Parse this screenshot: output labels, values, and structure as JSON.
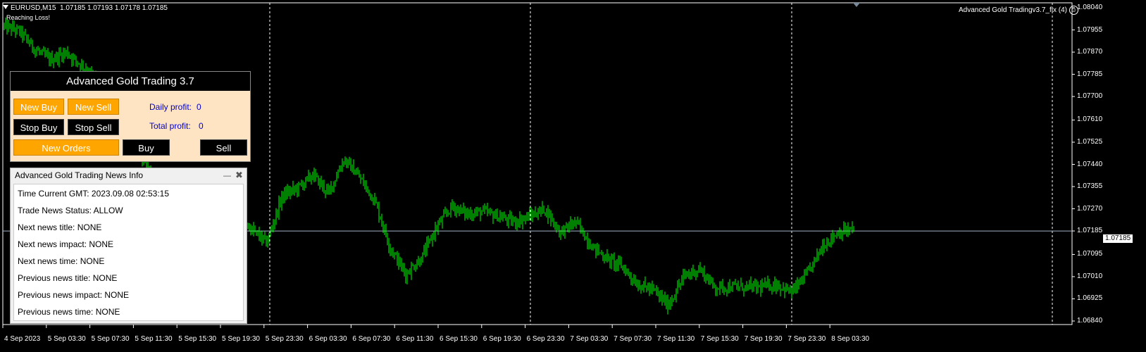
{
  "header": {
    "symbol": "EURUSD,M15",
    "ohlc": "1.07185 1.07193 1.07178 1.07185",
    "status": "Reaching Loss!",
    "ea_name": "Advanced Gold Tradingv3.7_fix (4)"
  },
  "price_axis": {
    "labels": [
      "1.08040",
      "1.07955",
      "1.07870",
      "1.07785",
      "1.07700",
      "1.07610",
      "1.07525",
      "1.07440",
      "1.07355",
      "1.07270",
      "1.07185",
      "1.07095",
      "1.07010",
      "1.06925",
      "1.06840"
    ],
    "current": "1.07185"
  },
  "time_axis": {
    "labels": [
      "4 Sep 2023",
      "5 Sep 03:30",
      "5 Sep 07:30",
      "5 Sep 11:30",
      "5 Sep 15:30",
      "5 Sep 19:30",
      "5 Sep 23:30",
      "6 Sep 03:30",
      "6 Sep 07:30",
      "6 Sep 11:30",
      "6 Sep 15:30",
      "6 Sep 19:30",
      "6 Sep 23:30",
      "7 Sep 03:30",
      "7 Sep 07:30",
      "7 Sep 11:30",
      "7 Sep 15:30",
      "7 Sep 19:30",
      "7 Sep 23:30",
      "8 Sep 03:30"
    ]
  },
  "trade_panel": {
    "title": "Advanced Gold Trading 3.7",
    "new_buy": "New Buy",
    "new_sell": "New Sell",
    "stop_buy": "Stop Buy",
    "stop_sell": "Stop Sell",
    "new_orders": "New Orders",
    "buy": "Buy",
    "sell": "Sell",
    "daily_profit_label": "Daily profit:",
    "daily_profit_value": "0",
    "total_profit_label": "Total profit:",
    "total_profit_value": "0"
  },
  "news_panel": {
    "title": "Advanced Gold Trading News Info",
    "lines": [
      "Time Current GMT: 2023.09.08 02:53:15",
      "Trade News Status: ALLOW",
      "Next news title: NONE",
      "Next news impact: NONE",
      "Next news time: NONE",
      "Previous news title: NONE",
      "Previous news impact: NONE",
      "Previous news time: NONE"
    ]
  },
  "chart_data": {
    "type": "candlestick",
    "symbol": "EURUSD",
    "timeframe": "M15",
    "ylim": [
      1.0684,
      1.0804
    ],
    "current_price": 1.07185,
    "close_path": [
      [
        0,
        1.0797
      ],
      [
        1,
        1.0795
      ],
      [
        2,
        1.0788
      ],
      [
        3,
        1.0784
      ],
      [
        4,
        1.0787
      ],
      [
        5,
        1.0782
      ],
      [
        6,
        1.0777
      ],
      [
        7,
        1.0768
      ],
      [
        8,
        1.0758
      ],
      [
        9,
        1.0745
      ],
      [
        10,
        1.0737
      ],
      [
        11,
        1.073
      ],
      [
        12,
        1.0722
      ],
      [
        13,
        1.0718
      ],
      [
        14,
        1.0722
      ],
      [
        15,
        1.0725
      ],
      [
        16,
        1.0719
      ],
      [
        17,
        1.0714
      ],
      [
        18,
        1.0732
      ],
      [
        19,
        1.0735
      ],
      [
        20,
        1.074
      ],
      [
        21,
        1.0733
      ],
      [
        22,
        1.0746
      ],
      [
        23,
        1.0739
      ],
      [
        24,
        1.073
      ],
      [
        25,
        1.0712
      ],
      [
        26,
        1.0702
      ],
      [
        27,
        1.0708
      ],
      [
        28,
        1.072
      ],
      [
        29,
        1.0728
      ],
      [
        30,
        1.0725
      ],
      [
        31,
        1.0726
      ],
      [
        32,
        1.0724
      ],
      [
        33,
        1.0722
      ],
      [
        34,
        1.0724
      ],
      [
        35,
        1.0727
      ],
      [
        36,
        1.0718
      ],
      [
        37,
        1.0722
      ],
      [
        38,
        1.0713
      ],
      [
        39,
        1.0708
      ],
      [
        40,
        1.0705
      ],
      [
        41,
        1.0698
      ],
      [
        42,
        1.0696
      ],
      [
        43,
        1.069
      ],
      [
        44,
        1.0701
      ],
      [
        45,
        1.0704
      ],
      [
        46,
        1.0697
      ],
      [
        47,
        1.0697
      ],
      [
        48,
        1.0697
      ],
      [
        49,
        1.0697
      ],
      [
        50,
        1.0698
      ],
      [
        51,
        1.0695
      ],
      [
        52,
        1.0702
      ],
      [
        53,
        1.0713
      ],
      [
        54,
        1.0718
      ],
      [
        55,
        1.0719
      ]
    ]
  }
}
